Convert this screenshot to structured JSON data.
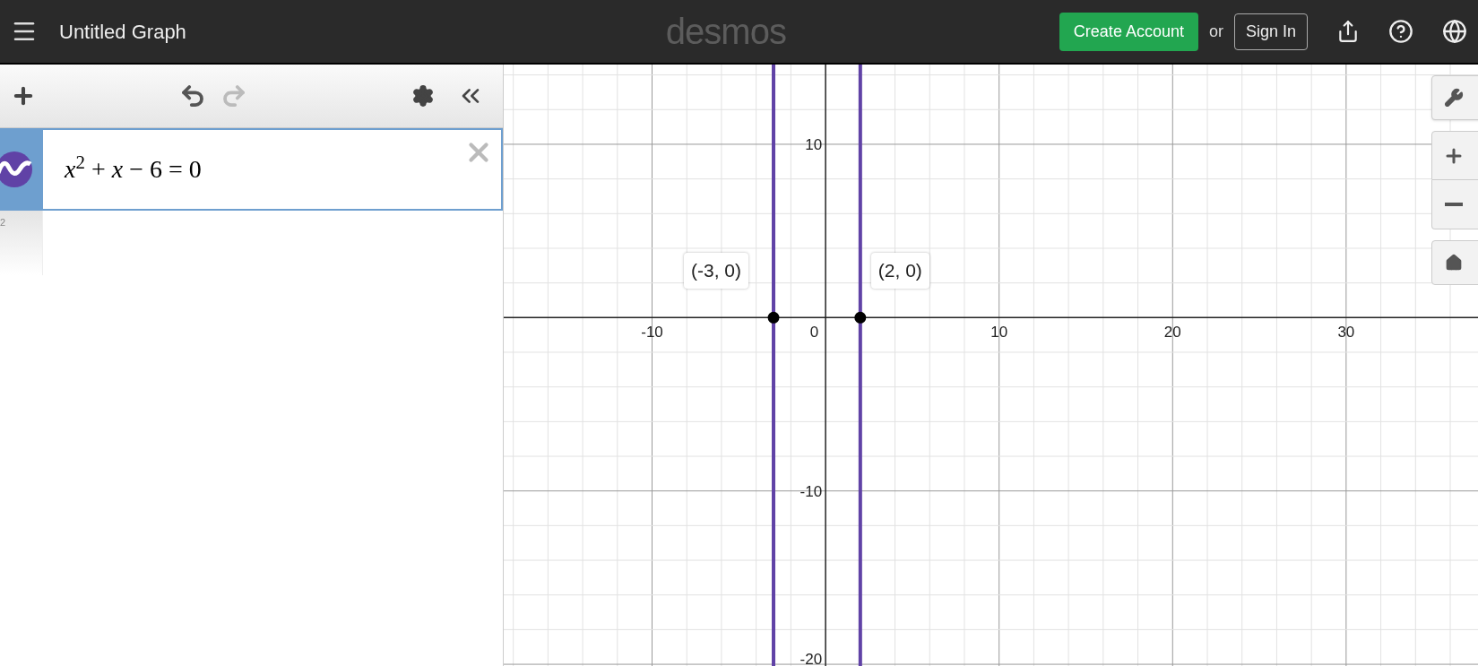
{
  "header": {
    "title": "Untitled Graph",
    "logo": "desmos",
    "create_account": "Create Account",
    "or": "or",
    "sign_in": "Sign In"
  },
  "expressions": [
    {
      "latex": "*x*$^{2}$ + *x* − 6 = 0",
      "color": "#6042a6",
      "kind": "equation"
    },
    {
      "number": "2",
      "kind": "empty"
    }
  ],
  "graph": {
    "origin_label": "0",
    "chart_data": {
      "type": "line",
      "xlim": [
        -18.55,
        37.6
      ],
      "ylim": [
        -20.1,
        14.6
      ],
      "xticks": [
        -10,
        10,
        20,
        30
      ],
      "yticks": [
        10,
        -10,
        -20
      ],
      "grid": true,
      "ref_lines": [
        {
          "axis": "x",
          "value": -3,
          "color": "#6042a6"
        },
        {
          "axis": "x",
          "value": 2,
          "color": "#6042a6"
        }
      ],
      "annotations": [
        {
          "x": -3,
          "y": 0,
          "text": "(-3, 0)"
        },
        {
          "x": 2,
          "y": 0,
          "text": "(2, 0)"
        }
      ]
    }
  }
}
